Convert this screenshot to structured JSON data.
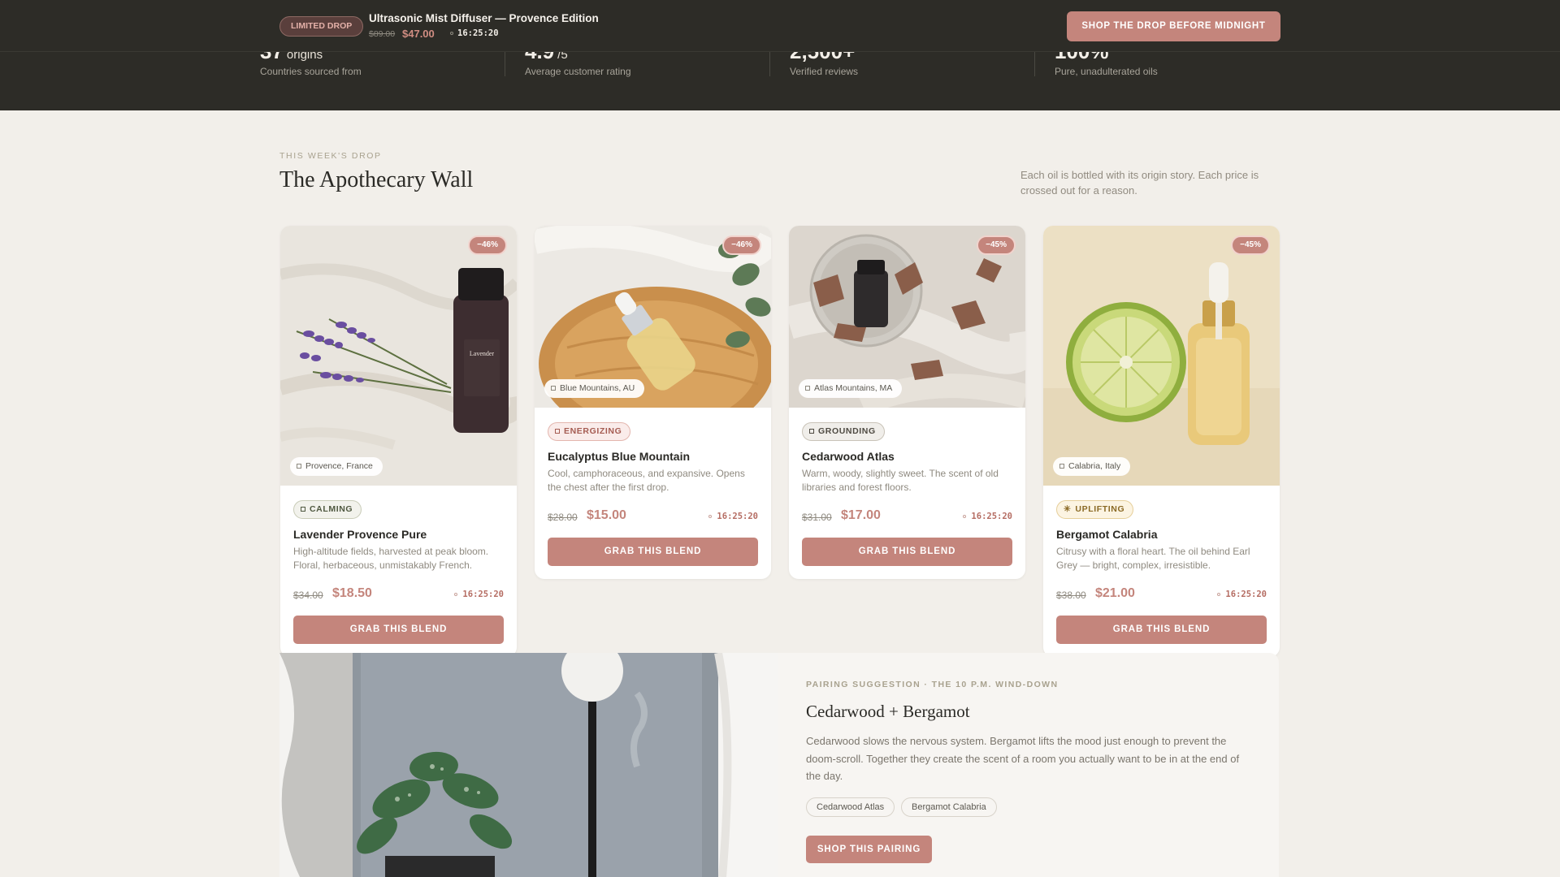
{
  "dropbar": {
    "badge": "LIMITED DROP",
    "title": "Ultrasonic Mist Diffuser — Provence Edition",
    "old_price": "$89.00",
    "new_price": "$47.00",
    "timer": "16:25:20",
    "cta": "SHOP THE DROP BEFORE MIDNIGHT"
  },
  "stats": [
    {
      "value": "37",
      "unit": "origins",
      "label": "Countries sourced from"
    },
    {
      "value": "4.9",
      "unit": "/5",
      "label": "Average customer rating"
    },
    {
      "value": "2,500+",
      "unit": "",
      "label": "Verified reviews"
    },
    {
      "value": "100%",
      "unit": "",
      "label": "Pure, unadulterated oils"
    }
  ],
  "section": {
    "eyebrow": "THIS WEEK'S DROP",
    "title": "The Apothecary Wall",
    "description": "Each oil is bottled with its origin story. Each price is crossed out for a reason."
  },
  "products": [
    {
      "discount": "−46%",
      "origin": "Provence, France",
      "tag": "CALMING",
      "name": "Lavender Provence Pure",
      "desc": "High-altitude fields, harvested at peak bloom. Floral, herbaceous, unmistakably French.",
      "old_price": "$34.00",
      "new_price": "$18.50",
      "timer": "16:25:20",
      "cta": "GRAB THIS BLEND"
    },
    {
      "discount": "−46%",
      "origin": "Blue Mountains, AU",
      "tag": "ENERGIZING",
      "name": "Eucalyptus Blue Mountain",
      "desc": "Cool, camphoraceous, and expansive. Opens the chest after the first drop.",
      "old_price": "$28.00",
      "new_price": "$15.00",
      "timer": "16:25:20",
      "cta": "GRAB THIS BLEND"
    },
    {
      "discount": "−45%",
      "origin": "Atlas Mountains, MA",
      "tag": "GROUNDING",
      "name": "Cedarwood Atlas",
      "desc": "Warm, woody, slightly sweet. The scent of old libraries and forest floors.",
      "old_price": "$31.00",
      "new_price": "$17.00",
      "timer": "16:25:20",
      "cta": "GRAB THIS BLEND"
    },
    {
      "discount": "−45%",
      "origin": "Calabria, Italy",
      "tag": "UPLIFTING",
      "name": "Bergamot Calabria",
      "desc": "Citrusy with a floral heart. The oil behind Earl Grey — bright, complex, irresistible.",
      "old_price": "$38.00",
      "new_price": "$21.00",
      "timer": "16:25:20",
      "cta": "GRAB THIS BLEND"
    }
  ],
  "pairing": {
    "eyebrow": "PAIRING SUGGESTION · THE 10 P.M. WIND-DOWN",
    "title": "Cedarwood + Bergamot",
    "text": "Cedarwood slows the nervous system. Bergamot lifts the mood just enough to prevent the doom-scroll. Together they create the scent of a room you actually want to be in at the end of the day.",
    "chips": [
      "Cedarwood Atlas",
      "Bergamot Calabria"
    ],
    "cta": "SHOP THIS PAIRING"
  },
  "colors": {
    "accent": "#c4857c",
    "dark": "#2d2c27",
    "background": "#f2efea"
  }
}
